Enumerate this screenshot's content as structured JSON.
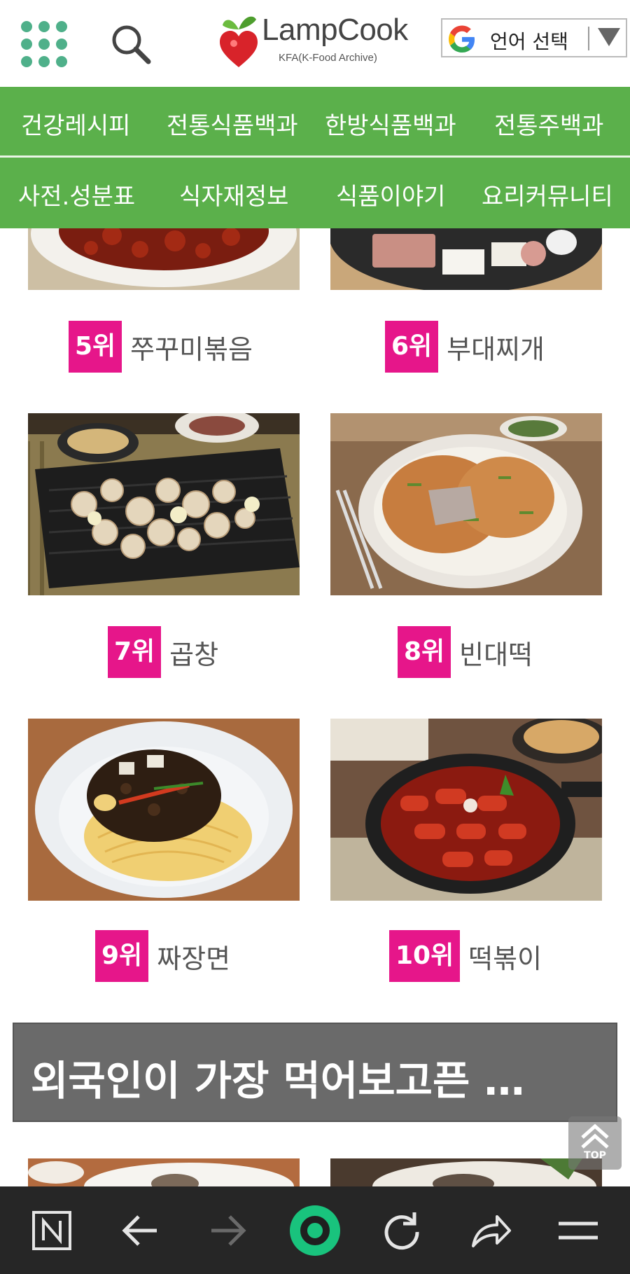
{
  "header": {
    "logo_title": "LampCook",
    "logo_subtitle": "KFA(K-Food Archive)",
    "language_select_label": "언어 선택"
  },
  "nav": {
    "row1": [
      "건강레시피",
      "전통식품백과",
      "한방식품백과",
      "전통주백과"
    ],
    "row2": [
      "사전.성분표",
      "식자재정보",
      "식품이야기",
      "요리커뮤니티"
    ]
  },
  "ranking": [
    {
      "rank": "5위",
      "name": "쭈꾸미볶음"
    },
    {
      "rank": "6위",
      "name": "부대찌개"
    },
    {
      "rank": "7위",
      "name": "곱창"
    },
    {
      "rank": "8위",
      "name": "빈대떡"
    },
    {
      "rank": "9위",
      "name": "짜장면"
    },
    {
      "rank": "10위",
      "name": "떡볶이"
    }
  ],
  "banner": {
    "title": "외국인이 가장 먹어보고픈 …"
  },
  "top_button": {
    "label": "TOP"
  },
  "colors": {
    "nav_green": "#5bb04b",
    "rank_badge": "#e6168a",
    "banner_gray": "#6a6a6a",
    "bottom_bar": "#262626",
    "browser_accent": "#19c37d"
  },
  "bottom_bar_icons": [
    "naver-n-icon",
    "back-arrow-icon",
    "forward-arrow-icon",
    "home-circle-icon",
    "refresh-icon",
    "share-icon",
    "menu-icon"
  ]
}
